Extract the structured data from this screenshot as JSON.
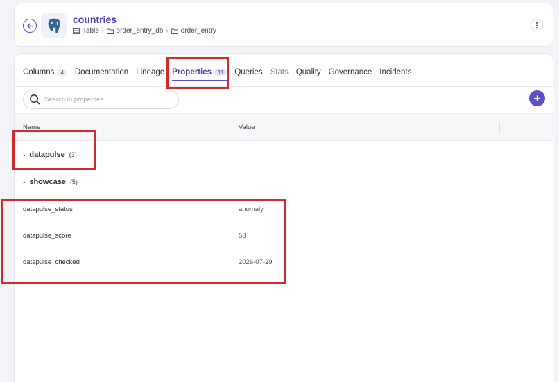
{
  "header": {
    "title": "countries",
    "breadcrumb": [
      "Table",
      "order_entry_db",
      "order_entry"
    ],
    "more_label": "⋮"
  },
  "tabs": [
    {
      "label": "Columns",
      "count": "4",
      "active": false,
      "muted": false
    },
    {
      "label": "Documentation",
      "count": "",
      "active": false,
      "muted": false
    },
    {
      "label": "Lineage",
      "count": "",
      "active": false,
      "muted": false
    },
    {
      "label": "Properties",
      "count": "11",
      "active": true,
      "muted": false
    },
    {
      "label": "Queries",
      "count": "",
      "active": false,
      "muted": false
    },
    {
      "label": "Stats",
      "count": "",
      "active": false,
      "muted": true
    },
    {
      "label": "Quality",
      "count": "",
      "active": false,
      "muted": false
    },
    {
      "label": "Governance",
      "count": "",
      "active": false,
      "muted": false
    },
    {
      "label": "Incidents",
      "count": "",
      "active": false,
      "muted": false
    }
  ],
  "search": {
    "placeholder": "Search in properties..."
  },
  "add_label": "+",
  "table": {
    "headers": {
      "name": "Name",
      "value": "Value"
    },
    "groups": [
      {
        "name": "datapulse",
        "count": "(3)"
      },
      {
        "name": "showcase",
        "count": "(5)"
      }
    ],
    "rows": [
      {
        "name": "datapulse_status",
        "value": "anomaly"
      },
      {
        "name": "datapulse_score",
        "value": "53"
      },
      {
        "name": "datapulse_checked",
        "value": "2026-07-29"
      }
    ]
  },
  "colors": {
    "accent": "#5b4fc9",
    "title": "#4a3bb5",
    "highlight": "#d12b2b"
  },
  "icons": [
    "back-arrow-icon",
    "postgres-logo-icon",
    "table-icon",
    "folder-icon",
    "more-vertical-icon",
    "search-icon",
    "plus-icon",
    "chevron-right-icon"
  ]
}
